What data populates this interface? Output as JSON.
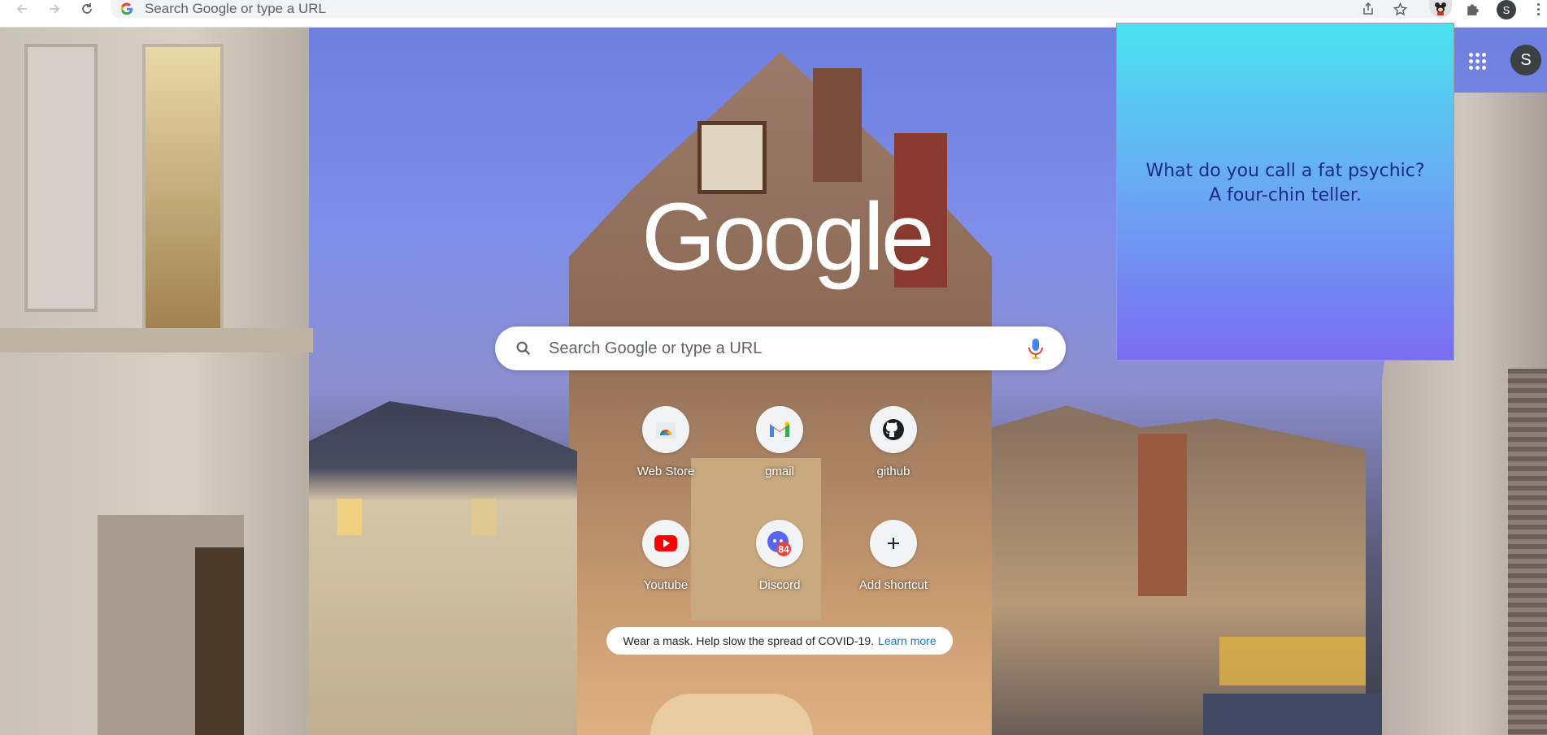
{
  "browser": {
    "omnibox_placeholder": "Search Google or type a URL",
    "profile_initial": "S",
    "icons": [
      "back-icon",
      "forward-icon",
      "reload-icon",
      "google-g-icon",
      "share-icon",
      "star-icon",
      "extension-mouse-icon",
      "puzzle-icon",
      "kebab-menu-icon"
    ]
  },
  "ntp": {
    "logo_text": "Google",
    "search_placeholder": "Search Google or type a URL",
    "shortcuts": [
      {
        "label": "Web Store",
        "icon": "chrome-web-store-icon"
      },
      {
        "label": "gmail",
        "icon": "gmail-icon"
      },
      {
        "label": "github",
        "icon": "github-icon"
      },
      {
        "label": "Youtube",
        "icon": "youtube-icon"
      },
      {
        "label": "Discord",
        "icon": "discord-icon",
        "badge": "84"
      },
      {
        "label": "Add shortcut",
        "icon": "plus-icon"
      }
    ],
    "promo_text": "Wear a mask. Help slow the spread of COVID-19.",
    "promo_link": "Learn more",
    "avatar_initial": "S"
  },
  "popup": {
    "joke": "What do you call a fat psychic? A four-chin teller."
  },
  "colors": {
    "popup_top": "#49e3ef",
    "popup_bottom": "#7b6cf2",
    "link": "#1a73e8"
  }
}
